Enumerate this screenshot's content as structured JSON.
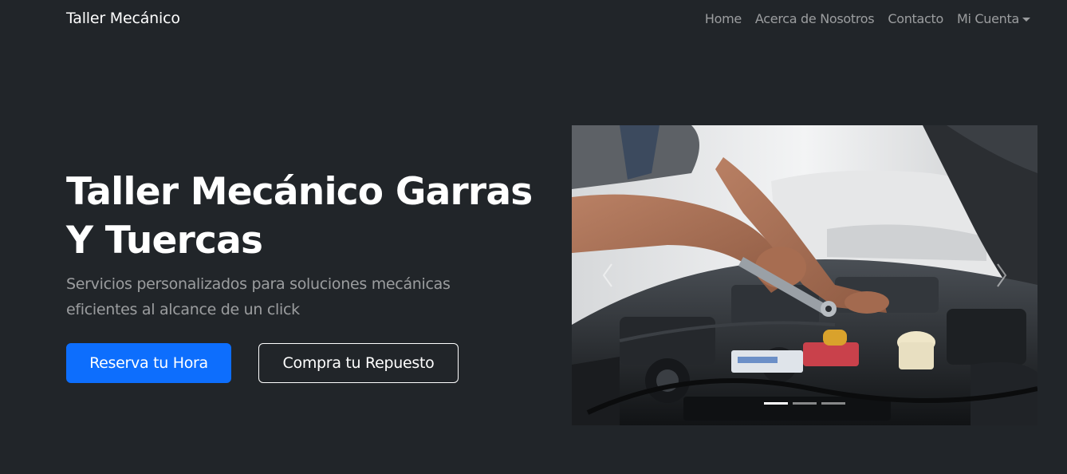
{
  "navbar": {
    "brand": "Taller Mecánico",
    "links": [
      {
        "label": "Home"
      },
      {
        "label": "Acerca de Nosotros"
      },
      {
        "label": "Contacto"
      },
      {
        "label": "Mi Cuenta"
      }
    ]
  },
  "hero": {
    "title": "Taller Mecánico Garras Y Tuercas",
    "subtitle": "Servicios personalizados para soluciones mecánicas eficientes al alcance de un click",
    "primary_button": "Reserva tu Hora",
    "secondary_button": "Compra tu Repuesto"
  },
  "carousel": {
    "indicator_count": 3,
    "active_index": 0
  },
  "colors": {
    "background": "#212529",
    "primary": "#0d6efd",
    "nav_link": "rgba(255,255,255,0.55)"
  },
  "icons": {
    "prev": "chevron-left-icon",
    "next": "chevron-right-icon",
    "dropdown": "caret-down-icon"
  }
}
